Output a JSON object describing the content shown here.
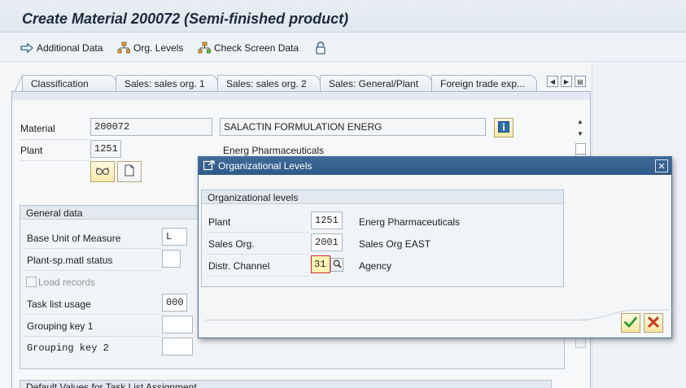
{
  "window": {
    "title": "Create Material 200072 (Semi-finished product)"
  },
  "toolbar": {
    "additional_data": "Additional Data",
    "org_levels": "Org. Levels",
    "check_screen_data": "Check Screen Data"
  },
  "tabs": [
    {
      "label": "Classification"
    },
    {
      "label": "Sales: sales org. 1"
    },
    {
      "label": "Sales: sales org. 2"
    },
    {
      "label": "Sales: General/Plant"
    },
    {
      "label": "Foreign trade exp..."
    }
  ],
  "header": {
    "material_label": "Material",
    "material_value": "200072",
    "material_description": "SALACTIN FORMULATION ENERG",
    "plant_label": "Plant",
    "plant_value": "1251",
    "plant_description": "Energ Pharmaceuticals"
  },
  "general_data": {
    "title": "General data",
    "fields": [
      {
        "label": "Base Unit of Measure",
        "value": "L"
      },
      {
        "label": "Plant-sp.matl status",
        "value": ""
      },
      {
        "label": "Load records",
        "checked": false
      },
      {
        "label": "Task list usage",
        "value": "000"
      },
      {
        "label": "Grouping key 1",
        "value": ""
      },
      {
        "label": "Grouping key 2",
        "value": ""
      }
    ]
  },
  "default_values_title": "Default Values for Task List Assignment",
  "dialog": {
    "title": "Organizational Levels",
    "group_title": "Organizational levels",
    "rows": [
      {
        "label": "Plant",
        "value": "1251",
        "description": "Energ Pharmaceuticals"
      },
      {
        "label": "Sales Org.",
        "value": "2001",
        "description": "Sales Org EAST"
      },
      {
        "label": "Distr. Channel",
        "value": "31",
        "description": "Agency"
      }
    ]
  },
  "colors": {
    "dialog_titlebar": "#2f5987",
    "confirm_green": "#2e9a2e",
    "cancel_red": "#c8391c"
  }
}
